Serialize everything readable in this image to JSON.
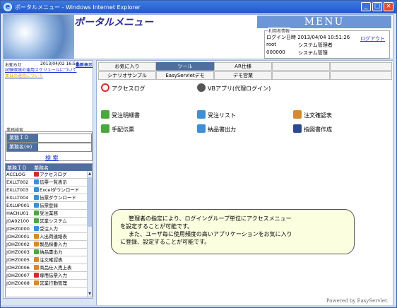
{
  "window": {
    "title": "ポータルメニュー - Windows Internet Explorer",
    "controls": [
      "_",
      "□",
      "×"
    ]
  },
  "header": {
    "portal_title": "ポータルメニュー",
    "menu_banner": "MENU",
    "userinfo_legend": "利用者情報",
    "login_time": "ログイン日時 2013/04/04 10:51:26",
    "logout": "ログアウト",
    "user_rows": [
      {
        "id": "root",
        "role": "システム管理者"
      },
      {
        "id": "000000",
        "role": "システム管理"
      }
    ]
  },
  "notice": {
    "label": "お知らせ",
    "date": "2013/04/02 16:54",
    "latest": "最新表示",
    "items": [
      "試験環境の運用スケジュールについて",
      "本日の運用について"
    ]
  },
  "search": {
    "legend": "業務検索",
    "field_id": "業務ＩＤ",
    "field_name": "業務名(※)",
    "button": "検 索"
  },
  "biz_table": {
    "col_id": "業務ＩＤ",
    "col_name": "業務名",
    "rows": [
      {
        "id": "ACCLOG",
        "name": "アクセスログ",
        "color": "#d42a2a"
      },
      {
        "id": "EXLLT002",
        "name": "伝票一覧表示",
        "color": "#3f8fd4"
      },
      {
        "id": "EXLLT003",
        "name": "Excelダウンロード",
        "color": "#3f8fd4"
      },
      {
        "id": "EXLLT004",
        "name": "伝票ダウンロード",
        "color": "#3f8fd4"
      },
      {
        "id": "EXLUP001",
        "name": "伝票登録",
        "color": "#3f8fd4"
      },
      {
        "id": "HACHU01",
        "name": "受注業務",
        "color": "#4ba83e"
      },
      {
        "id": "JOA02100",
        "name": "営業システム",
        "color": "#4ba83e"
      },
      {
        "id": "JOHZ0000",
        "name": "受注入力",
        "color": "#3f8fd4"
      },
      {
        "id": "JOHZ0001",
        "name": "入出荷連絡表",
        "color": "#d68b2b"
      },
      {
        "id": "JOHZ0002",
        "name": "製品採番入力",
        "color": "#d68b2b"
      },
      {
        "id": "JOHZ0003",
        "name": "納品書出力",
        "color": "#4ba83e"
      },
      {
        "id": "JOHZ0005",
        "name": "注文確認表",
        "color": "#d68b2b"
      },
      {
        "id": "JOHZ0006",
        "name": "商品仕入売上表",
        "color": "#d68b2b"
      },
      {
        "id": "JOHZ0007",
        "name": "専用伝票入力",
        "color": "#d42a2a"
      },
      {
        "id": "JOHZ0008",
        "name": "営業行動管理",
        "color": "#d68b2b"
      }
    ]
  },
  "tabs": {
    "row1": [
      "お気に入り",
      "ツール",
      "AR仕様"
    ],
    "row2": [
      "シナリオサンプル",
      "EasyServletデモ",
      "デモ営業"
    ],
    "active": "ツール"
  },
  "apps": [
    {
      "label": "アクセスログ",
      "icon": "red"
    },
    {
      "label": "VBアプリ(代理ログイン)",
      "icon": "dark"
    },
    {
      "label": "受注明細書",
      "icon": "green"
    },
    {
      "label": "受注リスト",
      "icon": "blue"
    },
    {
      "label": "注文確認表",
      "icon": "orange"
    },
    {
      "label": "手配伝票",
      "icon": "green"
    },
    {
      "label": "納品書出力",
      "icon": "blue"
    },
    {
      "label": "指図書作成",
      "icon": "navy"
    }
  ],
  "balloon": {
    "lines": [
      "管理者の指定により、ログイングループ単位にアクセスメニュー",
      "を設定することが可能です。",
      "また、ユーザ毎に使用頻度の高いアプリケーションをお気に入り",
      "に登録、設定することが可能です。"
    ]
  },
  "footer": {
    "powered": "Powered by EasyServlet."
  }
}
